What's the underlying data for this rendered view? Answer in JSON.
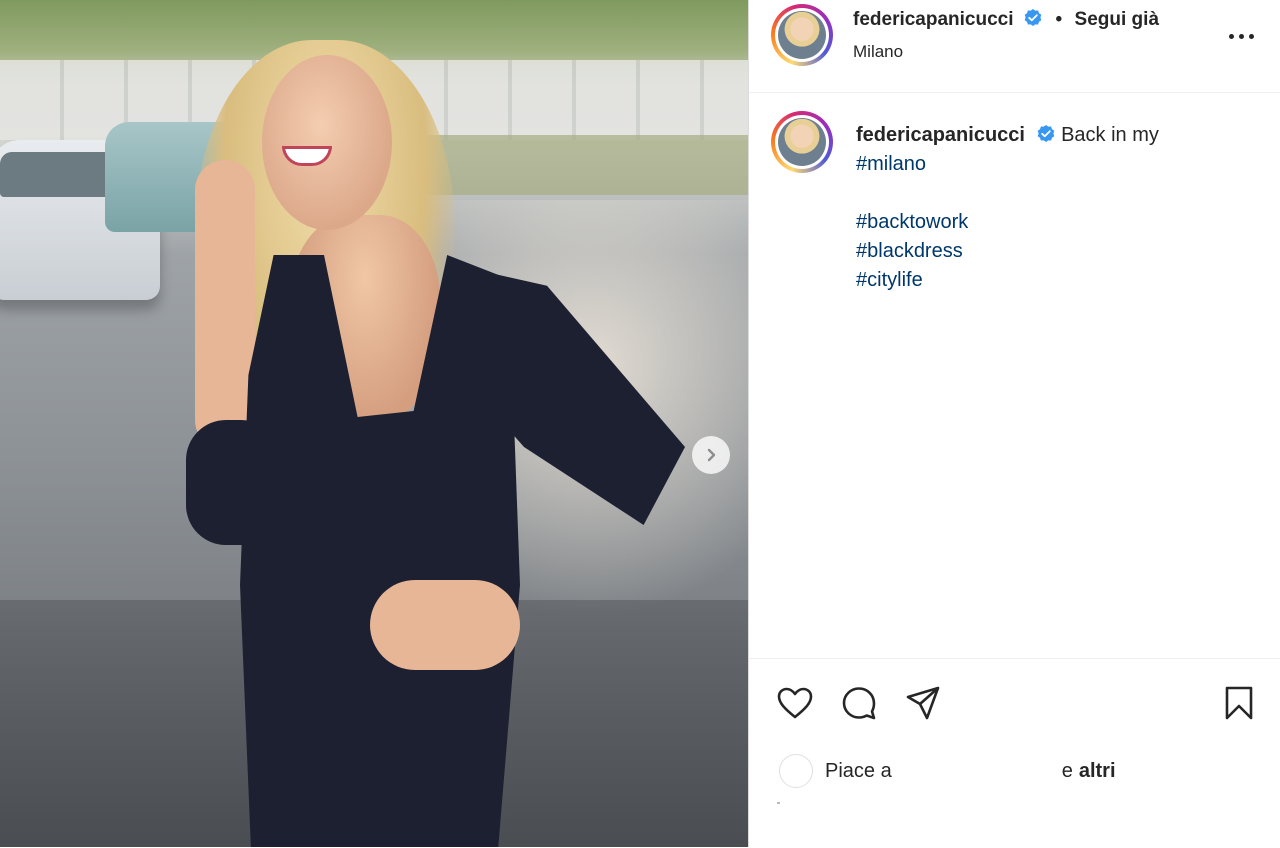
{
  "post": {
    "username": "federicapanicucci",
    "follow_status": "Segui già",
    "separator": "•",
    "location": "Milano"
  },
  "caption": {
    "username": "federicapanicucci",
    "text": "Back in my",
    "hashtags": [
      "#milano",
      "#backtowork",
      "#blackdress",
      "#citylife"
    ]
  },
  "likes": {
    "prefix": "Piace a",
    "connector": "e",
    "others": "altri"
  },
  "icons": {
    "verified": "verified-badge-icon",
    "more": "more-options-icon",
    "next": "chevron-right-icon",
    "like": "heart-icon",
    "comment": "comment-icon",
    "share": "send-icon",
    "save": "bookmark-icon"
  },
  "colors": {
    "verified": "#3897f0",
    "hashtag": "#00376b",
    "text": "#262626"
  }
}
